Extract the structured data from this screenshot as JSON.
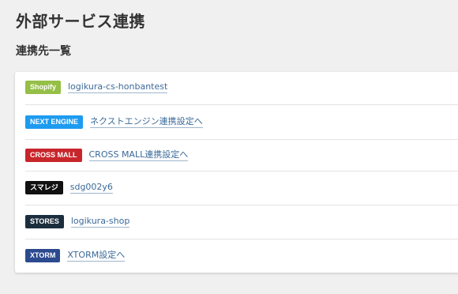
{
  "header": {
    "title": "外部サービス連携"
  },
  "section": {
    "title": "連携先一覧"
  },
  "integrations": [
    {
      "badge": "Shopify",
      "badge_color": "#95bf47",
      "link": "logikura-cs-honbantest"
    },
    {
      "badge": "NEXT ENGINE",
      "badge_color": "#1d9bf0",
      "link": "ネクストエンジン連携設定へ"
    },
    {
      "badge": "CROSS MALL",
      "badge_color": "#c8262b",
      "link": "CROSS MALL連携設定へ"
    },
    {
      "badge": "スマレジ",
      "badge_color": "#111111",
      "link": "sdg002y6"
    },
    {
      "badge": "STORES",
      "badge_color": "#1c2e3d",
      "link": "logikura-shop"
    },
    {
      "badge": "XTORM",
      "badge_color": "#2c4a8f",
      "link": "XTORM設定へ"
    }
  ]
}
